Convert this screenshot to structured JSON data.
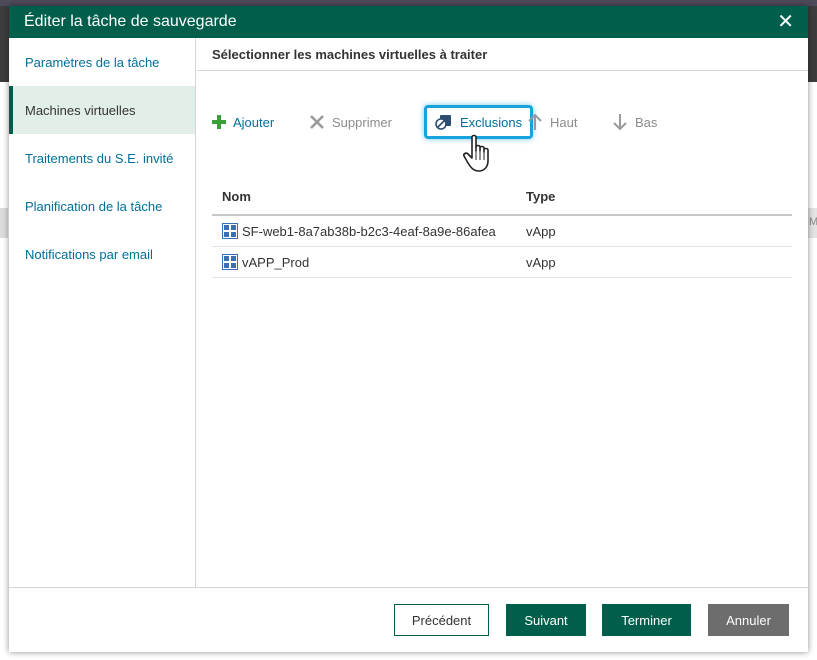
{
  "dialog": {
    "title": "Éditer la tâche de sauvegarde",
    "close_symbol": "✕"
  },
  "nav": {
    "items": [
      {
        "label": "Paramètres de la tâche",
        "active": false
      },
      {
        "label": "Machines virtuelles",
        "active": true
      },
      {
        "label": "Traitements du S.E. invité",
        "active": false
      },
      {
        "label": "Planification de la tâche",
        "active": false
      },
      {
        "label": "Notifications par email",
        "active": false
      }
    ]
  },
  "content": {
    "header": "Sélectionner les machines virtuelles à traiter"
  },
  "toolbar": {
    "add_label": "Ajouter",
    "remove_label": "Supprimer",
    "exclusions_label": "Exclusions",
    "up_label": "Haut",
    "down_label": "Bas"
  },
  "table": {
    "columns": [
      "Nom",
      "Type"
    ],
    "rows": [
      {
        "name": "SF-web1-8a7ab38b-b2c3-4eaf-8a9e-86afea",
        "type": "vApp"
      },
      {
        "name": "vAPP_Prod",
        "type": "vApp"
      }
    ]
  },
  "footer": {
    "prev_label": "Précédent",
    "next_label": "Suivant",
    "finish_label": "Terminer",
    "cancel_label": "Annuler"
  },
  "background": {
    "strip_text": "IM"
  },
  "colors": {
    "brand": "#005f4b",
    "link": "#006f9a",
    "highlight": "#18a3dc",
    "add_green": "#3aa03a",
    "cancel_gray": "#6d6d6d"
  }
}
